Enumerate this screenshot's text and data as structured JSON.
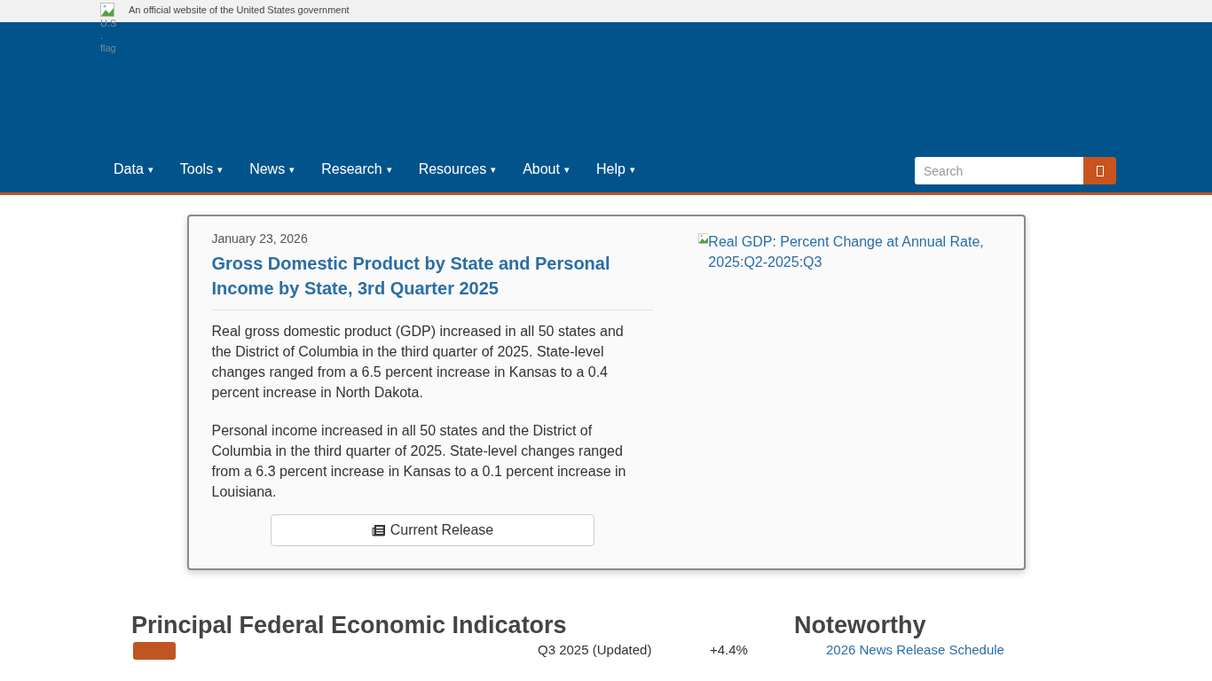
{
  "gov_banner": {
    "flag_alt": "U.S. flag",
    "text": "An official website of the United States government"
  },
  "nav": {
    "items": [
      {
        "label": "Data",
        "caret": "▾"
      },
      {
        "label": "Tools",
        "caret": "▾"
      },
      {
        "label": "News",
        "caret": "▾"
      },
      {
        "label": "Research",
        "caret": "▾"
      },
      {
        "label": "Resources",
        "caret": "▾"
      },
      {
        "label": "About",
        "caret": "▾"
      },
      {
        "label": "Help",
        "caret": "▾"
      }
    ],
    "search": {
      "placeholder": "Search"
    }
  },
  "feature": {
    "date": "January 23, 2026",
    "title": "Gross Domestic Product by State and Personal Income by State, 3rd Quarter 2025",
    "paragraphs": [
      "Real gross domestic product (GDP) increased in all 50 states and the District of Columbia in the third quarter of 2025. State-level changes ranged from a 6.5 percent increase in Kansas to a 0.4 percent increase in North Dakota.",
      "Personal income increased in all 50 states and the District of Columbia in the third quarter of 2025. State-level changes ranged from a 6.3 percent increase in Kansas to a 0.1 percent increase in Louisiana."
    ],
    "button": "Current Release",
    "image_alt": "Real GDP: Percent Change at Annual Rate, 2025:Q2-2025:Q3"
  },
  "indicators": {
    "heading": "Principal Federal Economic Indicators",
    "rows": [
      {
        "period": "Q3 2025 (Updated)",
        "value": "+4.4%"
      }
    ]
  },
  "noteworthy": {
    "heading": "Noteworthy",
    "links": [
      "2026 News Release Schedule"
    ]
  }
}
